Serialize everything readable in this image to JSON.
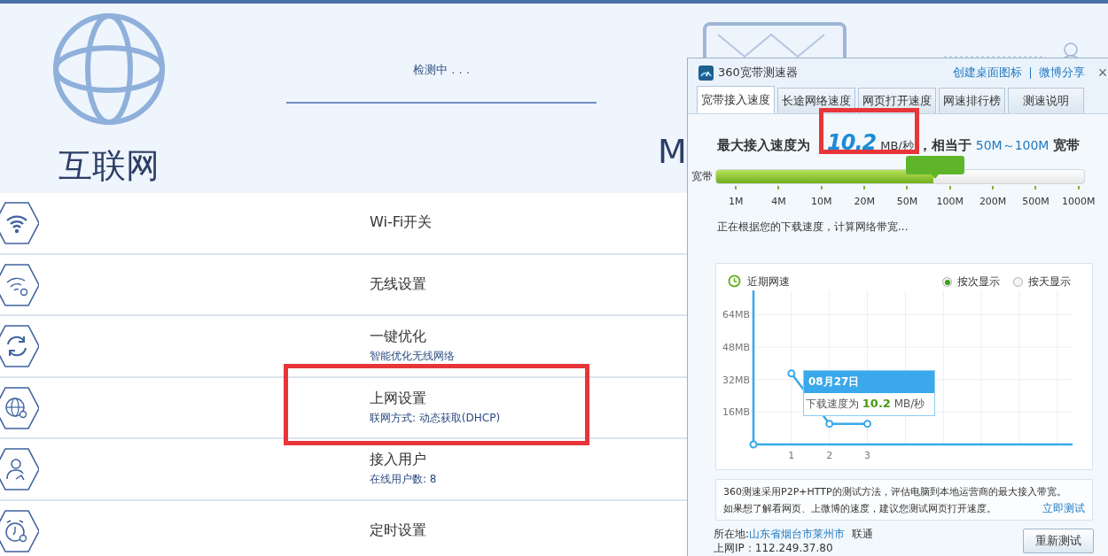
{
  "router_page": {
    "header": {
      "title": "互联网",
      "status": "检测中 . . .",
      "cut_text": "M"
    },
    "menu": [
      {
        "title": "Wi-Fi开关",
        "highlighted": false
      },
      {
        "title": "无线设置",
        "highlighted": false
      },
      {
        "title": "一键优化",
        "subtitle": "智能优化无线网络",
        "highlighted": false
      },
      {
        "title": "上网设置",
        "subtitle": "联网方式: 动态获取(DHCP)",
        "highlighted": true
      },
      {
        "title": "接入用户",
        "subtitle": "在线用户数: 8",
        "highlighted": false
      },
      {
        "title": "定时设置",
        "highlighted": false
      }
    ]
  },
  "speed_test_window": {
    "title": "360宽带测速器",
    "links": [
      "创建桌面图标",
      "微博分享"
    ],
    "close": "×",
    "tabs": [
      {
        "label": "宽带接入速度",
        "selected": true
      },
      {
        "label": "长途网络速度",
        "selected": false
      },
      {
        "label": "网页打开速度",
        "selected": false
      },
      {
        "label": "网速排行榜",
        "selected": false
      },
      {
        "label": "测速说明",
        "selected": false
      }
    ],
    "result": {
      "label": "最大接入速度为",
      "value": "10.2",
      "unit": "MB/秒",
      "equivalent": "，相当于",
      "range": "50M～100M",
      "suffix": "宽带",
      "highlighted": true
    },
    "bandwidth_bar": {
      "label": "宽带",
      "level": 0.59,
      "ticks": [
        "1M",
        "4M",
        "10M",
        "20M",
        "50M",
        "100M",
        "200M",
        "500M",
        "1000M"
      ]
    },
    "status": "正在根据您的下载速度，计算网络带宽...",
    "chart_panel": {
      "radios": [
        {
          "label": "按次显示",
          "selected": true
        },
        {
          "label": "按天显示",
          "selected": false
        }
      ],
      "chart_data": {
        "type": "line",
        "title": "近期网速",
        "grid": true,
        "x": [
          1,
          2,
          3
        ],
        "xlim": [
          0,
          8.4
        ],
        "ylim": [
          0,
          76
        ],
        "xticks": [
          1,
          2,
          3
        ],
        "yticks": [
          {
            "value": 16,
            "label": "16MB"
          },
          {
            "value": 32,
            "label": "32MB"
          },
          {
            "value": 48,
            "label": "48MB"
          },
          {
            "value": 64,
            "label": "64MB"
          }
        ],
        "series": [
          {
            "color": "#3aa8ea",
            "marker": true,
            "values": [
              35,
              10.2,
              10.2
            ]
          }
        ]
      },
      "tooltip": {
        "date": "08月27日",
        "label": "下载速度为",
        "value": "10.2",
        "unit": "MB/秒"
      }
    },
    "info": {
      "lines": [
        "360测速采用P2P+HTTP的测试方法，评估电脑到本地运营商的最大接入带宽。",
        "如果想了解看网页、上微博的速度，建议您测试网页打开速度。"
      ],
      "link": "立即测试"
    },
    "location": {
      "label": "所在地:",
      "place": "山东省烟台市莱州市",
      "isp": "联通"
    },
    "ip": {
      "label": "上网IP：",
      "value": "112.249.37.80"
    },
    "retest_button": "重新测试"
  }
}
